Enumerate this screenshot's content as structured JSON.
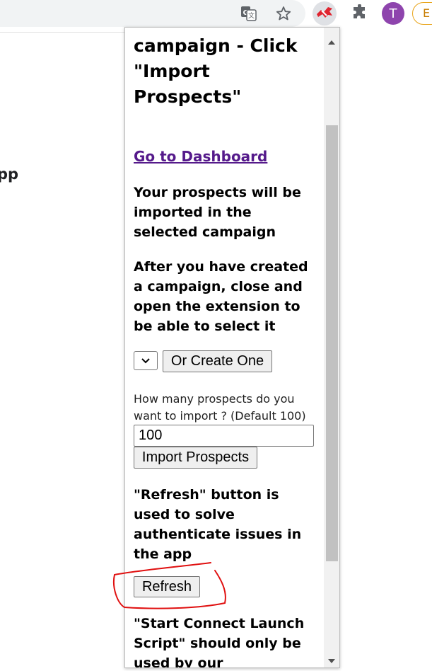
{
  "browser": {
    "profile_initial": "T",
    "profile_chip_letter": "E"
  },
  "background_page": {
    "partial_text": "pp"
  },
  "popup": {
    "title": "campaign - Click \"Import Prospects\"",
    "dashboard_link": "Go to Dashboard",
    "info_selected_campaign": "Your prospects will be imported in the selected campaign",
    "info_after_created": "After you have created a campaign, close and open the extension to be able to select it",
    "create_button": "Or Create One",
    "import_label": "How many prospects do you want to import ? (Default 100)",
    "import_count_value": "100",
    "import_button": "Import Prospects",
    "refresh_info": "\"Refresh\" button is used to solve authenticate issues in the app",
    "refresh_button": "Refresh",
    "launch_info": "\"Start Connect Launch Script\" should only be used by our development"
  },
  "colors": {
    "link": "#551a8b",
    "annotation": "#e01010",
    "avatar": "#8e44ad",
    "chip_border": "#e8a317"
  },
  "icons": [
    "translate-icon",
    "bookmark-star-icon",
    "extension-logo-icon",
    "puzzle-extensions-icon",
    "select-chevron-icon",
    "scroll-up-icon",
    "scroll-down-icon"
  ]
}
